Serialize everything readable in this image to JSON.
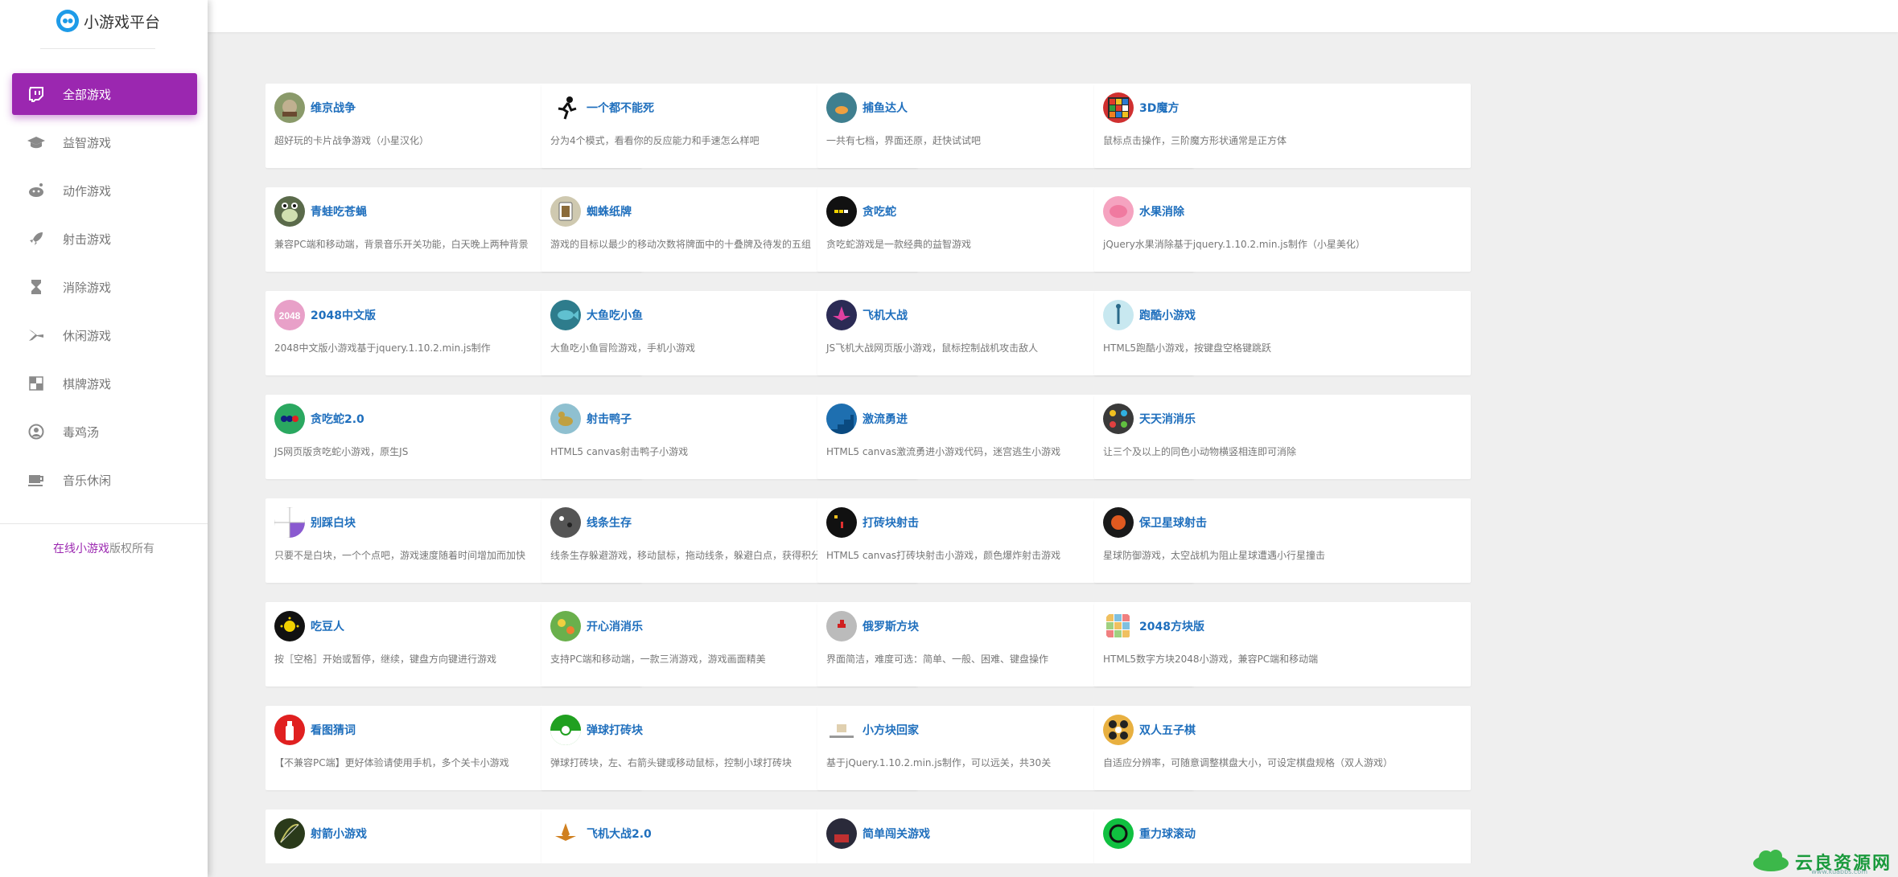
{
  "sidebar": {
    "logo_text": "小游戏平台",
    "nav": [
      {
        "label": "全部游戏",
        "icon": "twitch-icon",
        "active": true
      },
      {
        "label": "益智游戏",
        "icon": "graduation-cap-icon",
        "active": false
      },
      {
        "label": "动作游戏",
        "icon": "reddit-icon",
        "active": false
      },
      {
        "label": "射击游戏",
        "icon": "rocket-icon",
        "active": false
      },
      {
        "label": "消除游戏",
        "icon": "hourglass-icon",
        "active": false
      },
      {
        "label": "休闲游戏",
        "icon": "fighter-jet-icon",
        "active": false
      },
      {
        "label": "棋牌游戏",
        "icon": "checkerboard-icon",
        "active": false
      },
      {
        "label": "毒鸡汤",
        "icon": "user-circle-icon",
        "active": false
      },
      {
        "label": "音乐休闲",
        "icon": "coffee-icon",
        "active": false
      }
    ],
    "copyright": {
      "pre": "在线",
      "highlight": "小游戏",
      "post": "版权所有"
    }
  },
  "games": [
    {
      "title": "维京战争",
      "desc": "超好玩的卡片战争游戏（小星汉化）",
      "thumb": "viking-icon",
      "color": "#8a9a6a"
    },
    {
      "title": "一个都不能死",
      "desc": "分为4个模式，看看你的反应能力和手速怎么样吧",
      "thumb": "running-man-icon",
      "color": "#ffffff"
    },
    {
      "title": "捕鱼达人",
      "desc": "一共有七档，界面还原，赶快试试吧",
      "thumb": "fish-icon",
      "color": "#3f7f8f"
    },
    {
      "title": "3D魔方",
      "desc": "鼠标点击操作，三阶魔方形状通常是正方体",
      "thumb": "rubik-cube-icon",
      "color": "#d03030"
    },
    {
      "title": "青蛙吃苍蝇",
      "desc": "兼容PC端和移动端，背景音乐开关功能，白天晚上两种背景",
      "thumb": "frog-icon",
      "color": "#5a6a4a"
    },
    {
      "title": "蜘蛛纸牌",
      "desc": "游戏的目标以最少的移动次数将牌面中的十叠牌及待发的五组",
      "thumb": "card-icon",
      "color": "#cfc9b0"
    },
    {
      "title": "贪吃蛇",
      "desc": "贪吃蛇游戏是一款经典的益智游戏",
      "thumb": "snake-icon",
      "color": "#111111"
    },
    {
      "title": "水果消除",
      "desc": "jQuery水果消除基于jquery.1.10.2.min.js制作（小星美化）",
      "thumb": "fruit-icon",
      "color": "#f5a3c0"
    },
    {
      "title": "2048中文版",
      "desc": "2048中文版小游戏基于jquery.1.10.2.min.js制作",
      "thumb": "2048-icon",
      "color": "#e8a0c8"
    },
    {
      "title": "大鱼吃小鱼",
      "desc": "大鱼吃小鱼冒险游戏，手机小游戏",
      "thumb": "big-fish-icon",
      "color": "#2e7c8c"
    },
    {
      "title": "飞机大战",
      "desc": "JS飞机大战网页版小游戏，鼠标控制战机攻击敌人",
      "thumb": "plane-icon",
      "color": "#2b2b55"
    },
    {
      "title": "跑酷小游戏",
      "desc": "HTML5跑酷小游戏，按键盘空格键跳跃",
      "thumb": "parkour-icon",
      "color": "#c8e8f0"
    },
    {
      "title": "贪吃蛇2.0",
      "desc": "JS网页版贪吃蛇小游戏，原生JS",
      "thumb": "snake2-icon",
      "color": "#2aa860"
    },
    {
      "title": "射击鸭子",
      "desc": "HTML5 canvas射击鸭子小游戏",
      "thumb": "duck-icon",
      "color": "#8fc0d0"
    },
    {
      "title": "激流勇进",
      "desc": "HTML5 canvas激流勇进小游戏代码，迷宫逃生小游戏",
      "thumb": "stairs-icon",
      "color": "#1e6fb0"
    },
    {
      "title": "天天消消乐",
      "desc": "让三个及以上的同色小动物横竖相连即可消除",
      "thumb": "animals-icon",
      "color": "#3a3a3a"
    },
    {
      "title": "别踩白块",
      "desc": "只要不是白块，一个个点吧，游戏速度随着时间增加而加快",
      "thumb": "tiles-icon",
      "color": "#ffffff"
    },
    {
      "title": "线条生存",
      "desc": "线条生存躲避游戏，移动鼠标，拖动线条，躲避白点，获得积分",
      "thumb": "dots-icon",
      "color": "#555555"
    },
    {
      "title": "打砖块射击",
      "desc": "HTML5 canvas打砖块射击小游戏，颜色爆炸射击游戏",
      "thumb": "brick-shoot-icon",
      "color": "#111111"
    },
    {
      "title": "保卫星球射击",
      "desc": "星球防御游戏，太空战机为阻止星球遭遇小行星撞击",
      "thumb": "planet-icon",
      "color": "#1a1a1a"
    },
    {
      "title": "吃豆人",
      "desc": "按［空格］开始或暂停，继续，键盘方向键进行游戏",
      "thumb": "pacman-icon",
      "color": "#111111"
    },
    {
      "title": "开心消消乐",
      "desc": "支持PC端和移动端，一款三消游戏，游戏画面精美",
      "thumb": "happy-icon",
      "color": "#6ab04c"
    },
    {
      "title": "俄罗斯方块",
      "desc": "界面简洁，难度可选：简单、一般、困难、键盘操作",
      "thumb": "tetris-icon",
      "color": "#bbbbbb"
    },
    {
      "title": "2048方块版",
      "desc": "HTML5数字方块2048小游戏，兼容PC端和移动端",
      "thumb": "2048-block-icon",
      "color": "#ffffff"
    },
    {
      "title": "看图猜词",
      "desc": "【不兼容PC端】更好体验请使用手机，多个关卡小游戏",
      "thumb": "bottle-icon",
      "color": "#e02020"
    },
    {
      "title": "弹球打砖块",
      "desc": "弹球打砖块，左、右箭头键或移动鼠标，控制小球打砖块",
      "thumb": "ball-icon",
      "color": "#20a020"
    },
    {
      "title": "小方块回家",
      "desc": "基于jQuery.1.10.2.min.js制作，可以远关，共30关",
      "thumb": "cat-icon",
      "color": "#ffffff"
    },
    {
      "title": "双人五子棋",
      "desc": "自适应分辨率，可随意调整棋盘大小，可设定棋盘规格（双人游戏）",
      "thumb": "gomoku-icon",
      "color": "#e8b040"
    },
    {
      "title": "射箭小游戏",
      "desc": "",
      "thumb": "archery-icon",
      "color": "#2a3a1a"
    },
    {
      "title": "飞机大战2.0",
      "desc": "",
      "thumb": "plane2-icon",
      "color": "#ffffff"
    },
    {
      "title": "简单闯关游戏",
      "desc": "",
      "thumb": "level-icon",
      "color": "#2a2a3a"
    },
    {
      "title": "重力球滚动",
      "desc": "",
      "thumb": "gravity-ball-icon",
      "color": "#10c040"
    }
  ],
  "watermark": {
    "text": "云良资源网",
    "sub": "www.kuabbs.com"
  }
}
